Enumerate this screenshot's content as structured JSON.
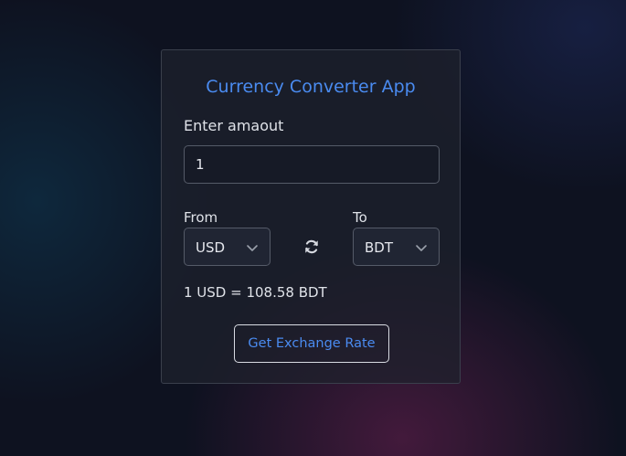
{
  "app": {
    "title": "Currency Converter App"
  },
  "amount": {
    "label": "Enter amaout",
    "value": "1"
  },
  "from": {
    "label": "From",
    "selected": "USD"
  },
  "to": {
    "label": "To",
    "selected": "BDT"
  },
  "icons": {
    "swap": "swap-arrows-icon",
    "dropdown": "chevron-down-icon"
  },
  "rate": {
    "text": "1 USD = 108.58 BDT"
  },
  "button": {
    "label": "Get Exchange Rate"
  },
  "colors": {
    "accent": "#4a8bf0",
    "card_background": "#1e212c",
    "page_background": "#0e1220",
    "border": "#555b68",
    "text": "#dfe2e8"
  }
}
